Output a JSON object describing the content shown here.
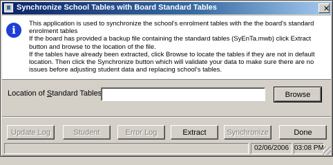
{
  "window": {
    "title": "Synchronize School Tables with Board Standard Tables",
    "close_glyph": "✕"
  },
  "info": {
    "icon_glyph": "i",
    "lines": [
      "This application is used to synchronize the school's enrolment tables with the the board's standard enrolment tables",
      "If the board has provided a backup file containing the standard tables (SyEnTa.mwb) click Extract button and browse to the location of the file.",
      "If the tables have already been extracted, click Browse to locate the tables if they are not in default location.     Then click the Synchronize button which will validate your data to make sure there are no issues before adjusting student data and replacing school's tables."
    ]
  },
  "location": {
    "label_prefix": "Location of ",
    "label_underlined": "S",
    "label_suffix": "tandard Tables:",
    "value": "",
    "browse_label": "Browse"
  },
  "buttons": {
    "update_log": "Update Log",
    "student": "Student",
    "error_log": "Error Log",
    "extract": "Extract",
    "synchronize": "Synchronize",
    "done": "Done"
  },
  "status": {
    "main": "",
    "date": "02/06/2006",
    "time": "03:08 PM"
  }
}
